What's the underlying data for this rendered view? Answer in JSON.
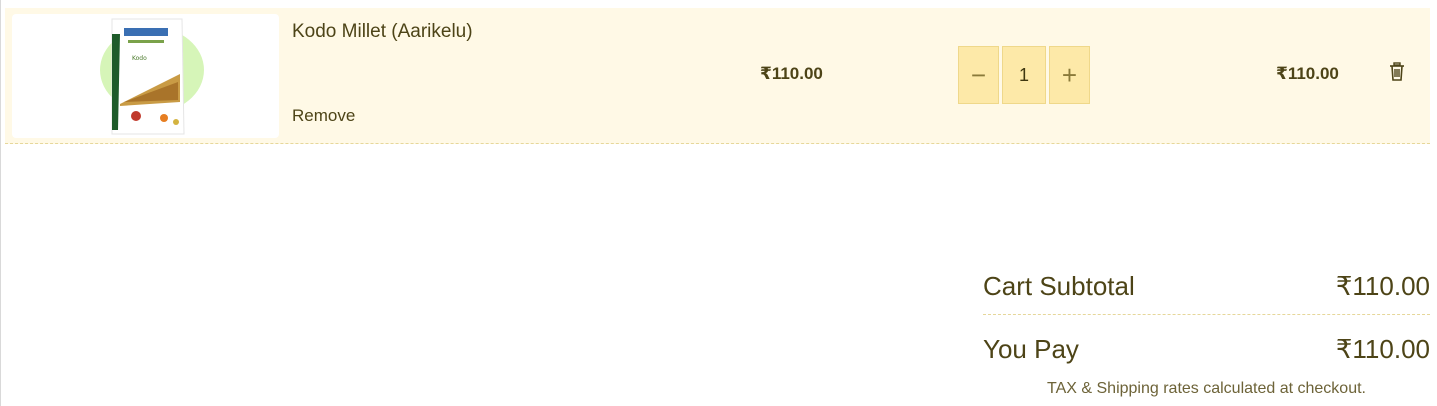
{
  "cart": {
    "items": [
      {
        "name": "Kodo Millet (Aarikelu)",
        "remove_label": "Remove",
        "unit_price": "₹110.00",
        "quantity": "1",
        "line_total": "₹110.00",
        "image_icon": "millet-package-image",
        "decrease_symbol": "−",
        "increase_symbol": "+"
      }
    ]
  },
  "summary": {
    "subtotal_label": "Cart Subtotal",
    "subtotal_value": "₹110.00",
    "pay_label": "You Pay",
    "pay_value": "₹110.00",
    "note": "TAX & Shipping rates calculated at checkout."
  },
  "colors": {
    "row_bg": "#fff9e6",
    "qty_bg": "#fde9a8",
    "text": "#4d4417"
  }
}
